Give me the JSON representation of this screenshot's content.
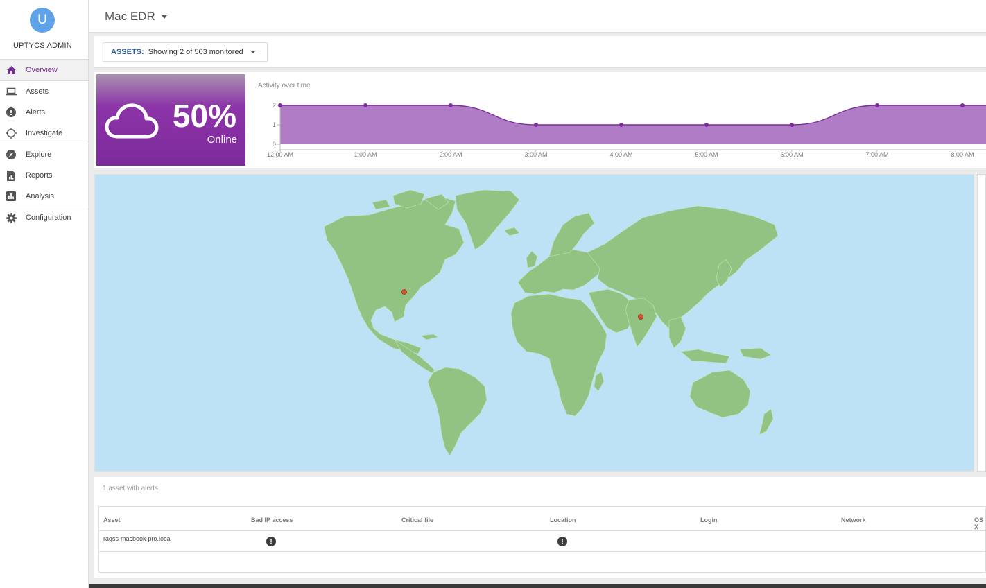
{
  "sidebar": {
    "avatar_letter": "U",
    "admin_name": "UPTYCS ADMIN",
    "items": [
      {
        "label": "Overview",
        "icon": "home-icon"
      },
      {
        "label": "Assets",
        "icon": "laptop-icon"
      },
      {
        "label": "Alerts",
        "icon": "alert-icon"
      },
      {
        "label": "Investigate",
        "icon": "crosshair-icon"
      },
      {
        "label": "Explore",
        "icon": "compass-icon"
      },
      {
        "label": "Reports",
        "icon": "report-icon"
      },
      {
        "label": "Analysis",
        "icon": "bar-chart-icon"
      },
      {
        "label": "Configuration",
        "icon": "gear-icon"
      }
    ],
    "active": "Overview"
  },
  "header": {
    "title": "Mac EDR"
  },
  "assets_filter": {
    "label": "ASSETS:",
    "text": "Showing 2 of 503 monitored"
  },
  "status": {
    "percent": "50%",
    "label": "Online"
  },
  "chart_data": {
    "type": "area",
    "title": "Activity over time",
    "x": [
      "12:00 AM",
      "1:00 AM",
      "2:00 AM",
      "3:00 AM",
      "4:00 AM",
      "5:00 AM",
      "6:00 AM",
      "7:00 AM",
      "8:00 AM"
    ],
    "series": [
      {
        "values": [
          2,
          2,
          2,
          1,
          1,
          1,
          1,
          2,
          2
        ]
      }
    ],
    "yticks": [
      0,
      1,
      2
    ],
    "ylim": [
      0,
      2
    ],
    "grid": false,
    "color": "#b07cc6",
    "line_color": "#7b2d9c"
  },
  "map": {
    "markers": [
      "United States",
      "India"
    ]
  },
  "alerts": {
    "title": "1 asset with alerts",
    "columns": [
      "Asset",
      "Bad IP access",
      "Critical file",
      "Location",
      "Login",
      "Network",
      "OS X"
    ],
    "rows": [
      {
        "asset": "ragss-macbook-pro.local",
        "bad_ip_access": "!",
        "critical_file": "",
        "location": "!",
        "login": "",
        "network": "",
        "os_x": ""
      }
    ]
  },
  "colors": {
    "accent": "#7b2d9c",
    "map_water": "#bde1f5",
    "map_land": "#93c383",
    "marker": "#d9532c"
  }
}
